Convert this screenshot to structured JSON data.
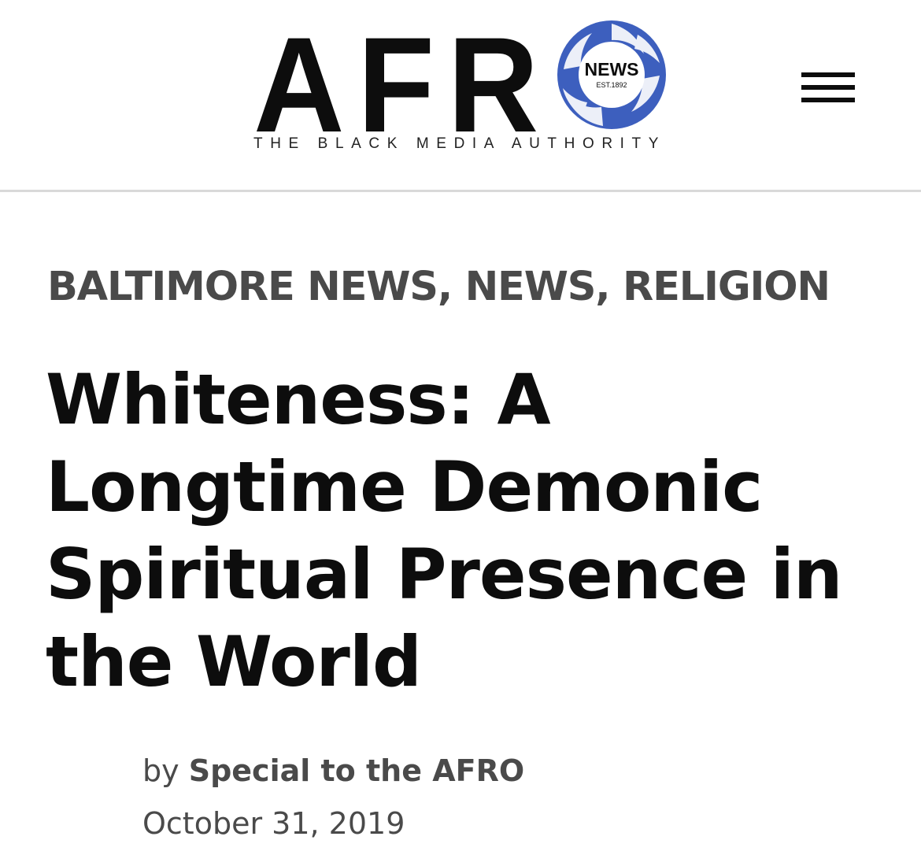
{
  "header": {
    "logo": {
      "wordmark": "AFR",
      "emblem_text": "NEWS",
      "emblem_subtext": "EST.1892",
      "tagline": "THE BLACK MEDIA AUTHORITY",
      "emblem_color": "#3d5fbe"
    },
    "menu_icon": "hamburger-menu-icon"
  },
  "article": {
    "categories": [
      "BALTIMORE NEWS",
      "NEWS",
      "RELIGION"
    ],
    "category_separator": ", ",
    "headline": "Whiteness: A Longtime Demonic Spiritual Presence in the World",
    "byline_prefix": "by",
    "author": "Special to the AFRO",
    "date": "October 31, 2019"
  },
  "colors": {
    "text_primary": "#0d0d0d",
    "text_secondary": "#4a4a4a",
    "divider": "#d9d9d9",
    "brand_blue": "#3d5fbe"
  }
}
